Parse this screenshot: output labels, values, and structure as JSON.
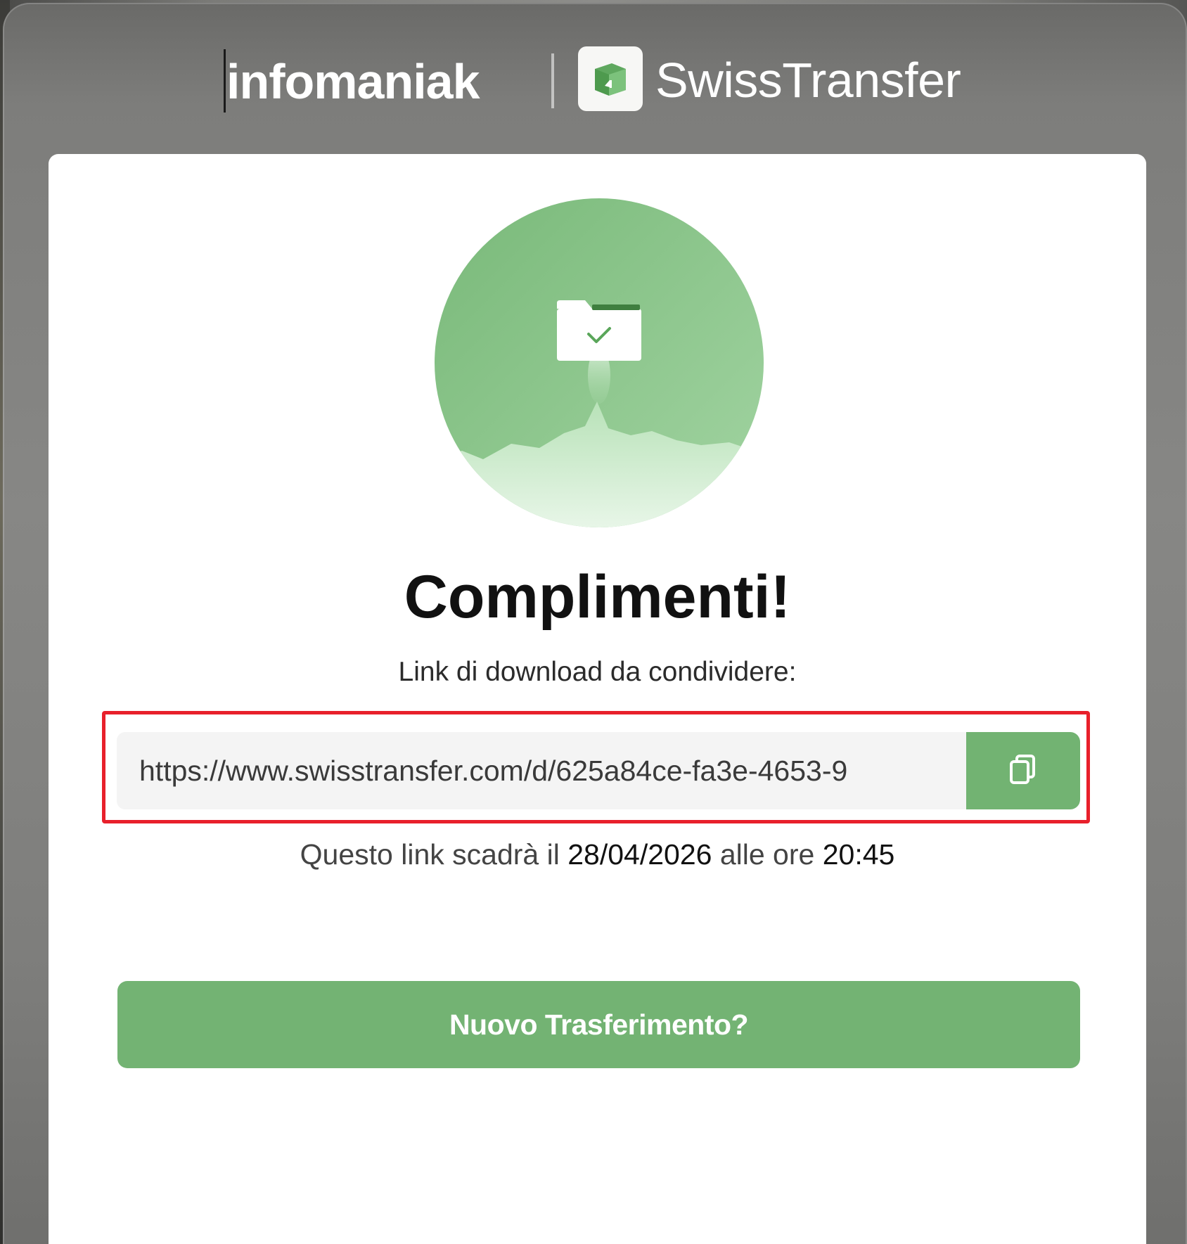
{
  "header": {
    "brand_primary": "infomaniak",
    "brand_product": "SwissTransfer",
    "logo_icon": "swisstransfer-logo-icon"
  },
  "main": {
    "illustration_icon": "folder-rocket-check-icon",
    "title": "Complimenti!",
    "subtitle": "Link di download da condividere:",
    "link_value": "https://www.swisstransfer.com/d/625a84ce-fa3e-4653-9",
    "copy_icon": "copy-icon",
    "expiry_prefix": "Questo link scadrà il",
    "expiry_date": "28/04/2026",
    "expiry_middle": "alle ore",
    "expiry_time": "20:45",
    "new_transfer_label": "Nuovo Trasferimento?"
  },
  "colors": {
    "accent_green": "#72b372",
    "highlight_red": "#e8202b",
    "title_text": "#111111"
  }
}
